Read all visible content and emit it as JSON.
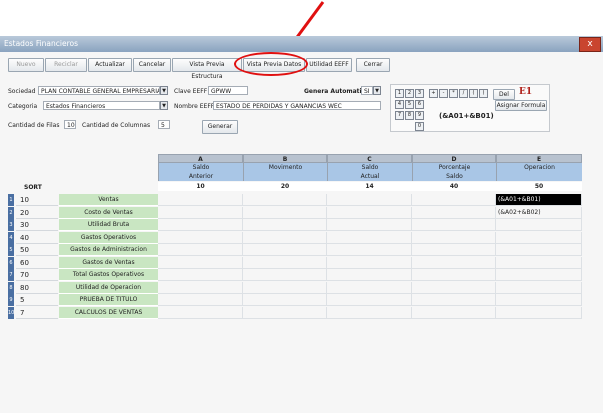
{
  "window": {
    "title": "Estados Financieros",
    "close_label": "x"
  },
  "toolbar": {
    "nuevo": "Nuevo",
    "reciclar": "Reciclar",
    "actualizar": "Actualizar",
    "cancelar": "Cancelar",
    "vista_estructura": "Vista Previa Estructura",
    "vista_datos": "Vista Previa Datos",
    "utilidad": "Utilidad EEFF",
    "cerrar": "Cerrar"
  },
  "form": {
    "sociedad_label": "Sociedad",
    "sociedad_value": "PLAN CONTABLE GENERAL EMPRESARIAL",
    "clave_label": "Clave EEFF",
    "clave_value": "GPWW",
    "genera_label": "Genera Automatico",
    "genera_value": "SI",
    "categoria_label": "Categoria",
    "categoria_value": "Estados Financieros",
    "nombre_label": "Nombre EEFF",
    "nombre_value": "ESTADO DE PERDIDAS Y GANANCIAS WEC",
    "filas_label": "Cantidad de Filas",
    "filas_value": "10",
    "columnas_label": "Cantidad de Columnas",
    "columnas_value": "5",
    "generar": "Generar"
  },
  "calc": {
    "keys_row1": [
      "1",
      "2",
      "3",
      "+",
      "-",
      "*",
      "/",
      "(",
      ")"
    ],
    "keys_row2": [
      "4",
      "5",
      "6"
    ],
    "keys_row3": [
      "7",
      "8",
      "9"
    ],
    "keys_row4": [
      "0"
    ],
    "del_label": "Del",
    "cell_ref": "E1",
    "asignar_label": "Asignar Formula",
    "formula": "(&A01+&B01)"
  },
  "grid": {
    "sort_header": "SORT",
    "columns": [
      {
        "letter": "A",
        "line1": "Saldo",
        "line2": "Anterior",
        "num": "10"
      },
      {
        "letter": "B",
        "line1": "Movimento",
        "line2": "",
        "num": "20"
      },
      {
        "letter": "C",
        "line1": "Saldo",
        "line2": "Actual",
        "num": "14"
      },
      {
        "letter": "D",
        "line1": "Porcentaje",
        "line2": "Saldo",
        "num": "40"
      },
      {
        "letter": "E",
        "line1": "Operacion",
        "line2": "",
        "num": "50"
      }
    ],
    "rows": [
      {
        "idx": "1",
        "sort": "10",
        "name": "Ventas",
        "e": "(&A01+&B01)"
      },
      {
        "idx": "2",
        "sort": "20",
        "name": "Costo de Ventas",
        "e": "(&A02+&B02)"
      },
      {
        "idx": "3",
        "sort": "30",
        "name": "Utilidad Bruta",
        "e": ""
      },
      {
        "idx": "4",
        "sort": "40",
        "name": "Gastos Operativos",
        "e": ""
      },
      {
        "idx": "5",
        "sort": "50",
        "name": "Gastos de Administracion",
        "e": ""
      },
      {
        "idx": "6",
        "sort": "60",
        "name": "Gastos de Ventas",
        "e": ""
      },
      {
        "idx": "7",
        "sort": "70",
        "name": "Total Gastos Operativos",
        "e": ""
      },
      {
        "idx": "8",
        "sort": "80",
        "name": "Utilidad de Operacion",
        "e": ""
      },
      {
        "idx": "9",
        "sort": "5",
        "name": "PRUEBA DE TITULO",
        "e": ""
      },
      {
        "idx": "10",
        "sort": "7",
        "name": "CALCULOS DE VENTAS",
        "e": ""
      }
    ]
  },
  "colors": {
    "highlight": "#e01010",
    "row_header": "#4a6fa2",
    "name_col": "#c9e6c2",
    "col_blue": "#a9c6e6"
  }
}
